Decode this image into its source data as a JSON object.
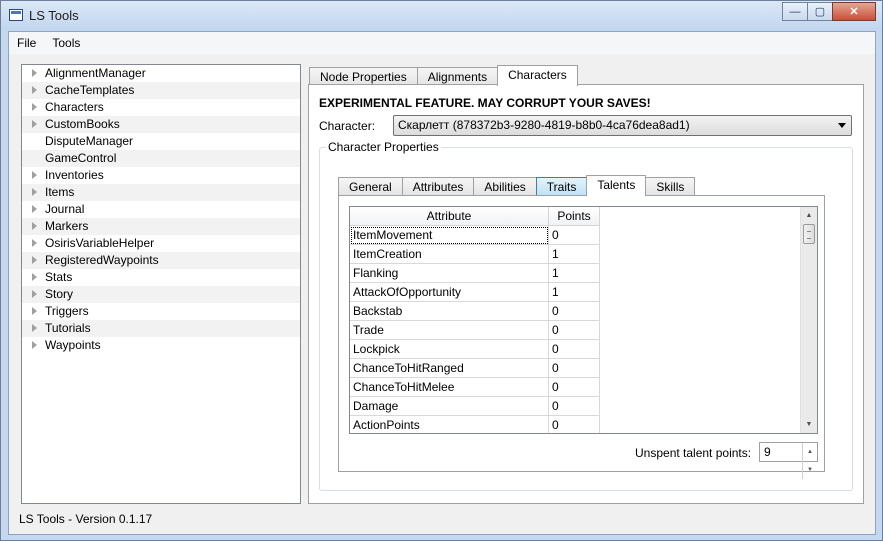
{
  "window": {
    "title": "LS Tools",
    "controls": {
      "minimize": "—",
      "maximize": "▢",
      "close": "✕"
    }
  },
  "menu": [
    {
      "label": "File"
    },
    {
      "label": "Tools"
    }
  ],
  "tree": {
    "items": [
      {
        "label": "AlignmentManager",
        "expandable": true
      },
      {
        "label": "CacheTemplates",
        "expandable": true
      },
      {
        "label": "Characters",
        "expandable": true
      },
      {
        "label": "CustomBooks",
        "expandable": true
      },
      {
        "label": "DisputeManager",
        "expandable": false
      },
      {
        "label": "GameControl",
        "expandable": false
      },
      {
        "label": "Inventories",
        "expandable": true
      },
      {
        "label": "Items",
        "expandable": true
      },
      {
        "label": "Journal",
        "expandable": true
      },
      {
        "label": "Markers",
        "expandable": true
      },
      {
        "label": "OsirisVariableHelper",
        "expandable": true
      },
      {
        "label": "RegisteredWaypoints",
        "expandable": true
      },
      {
        "label": "Stats",
        "expandable": true
      },
      {
        "label": "Story",
        "expandable": true
      },
      {
        "label": "Triggers",
        "expandable": true
      },
      {
        "label": "Tutorials",
        "expandable": true
      },
      {
        "label": "Waypoints",
        "expandable": true
      }
    ]
  },
  "tabs": [
    {
      "label": "Node Properties"
    },
    {
      "label": "Alignments"
    },
    {
      "label": "Characters"
    }
  ],
  "characters_panel": {
    "warning": "EXPERIMENTAL FEATURE.  MAY CORRUPT YOUR SAVES!",
    "character_label": "Character:",
    "character_value": "Скарлетт (878372b3-9280-4819-b8b0-4ca76dea8ad1)",
    "group_title": "Character Properties",
    "subtabs": [
      {
        "label": "General"
      },
      {
        "label": "Attributes"
      },
      {
        "label": "Abilities"
      },
      {
        "label": "Traits"
      },
      {
        "label": "Talents"
      },
      {
        "label": "Skills"
      }
    ],
    "grid": {
      "headers": {
        "attribute": "Attribute",
        "points": "Points"
      },
      "rows": [
        {
          "attribute": "ItemMovement",
          "points": "0"
        },
        {
          "attribute": "ItemCreation",
          "points": "1"
        },
        {
          "attribute": "Flanking",
          "points": "1"
        },
        {
          "attribute": "AttackOfOpportunity",
          "points": "1"
        },
        {
          "attribute": "Backstab",
          "points": "0"
        },
        {
          "attribute": "Trade",
          "points": "0"
        },
        {
          "attribute": "Lockpick",
          "points": "0"
        },
        {
          "attribute": "ChanceToHitRanged",
          "points": "0"
        },
        {
          "attribute": "ChanceToHitMelee",
          "points": "0"
        },
        {
          "attribute": "Damage",
          "points": "0"
        },
        {
          "attribute": "ActionPoints",
          "points": "0"
        }
      ]
    },
    "unspent_label": "Unspent talent points:",
    "unspent_value": "9"
  },
  "status": "LS Tools - Version 0.1.17"
}
